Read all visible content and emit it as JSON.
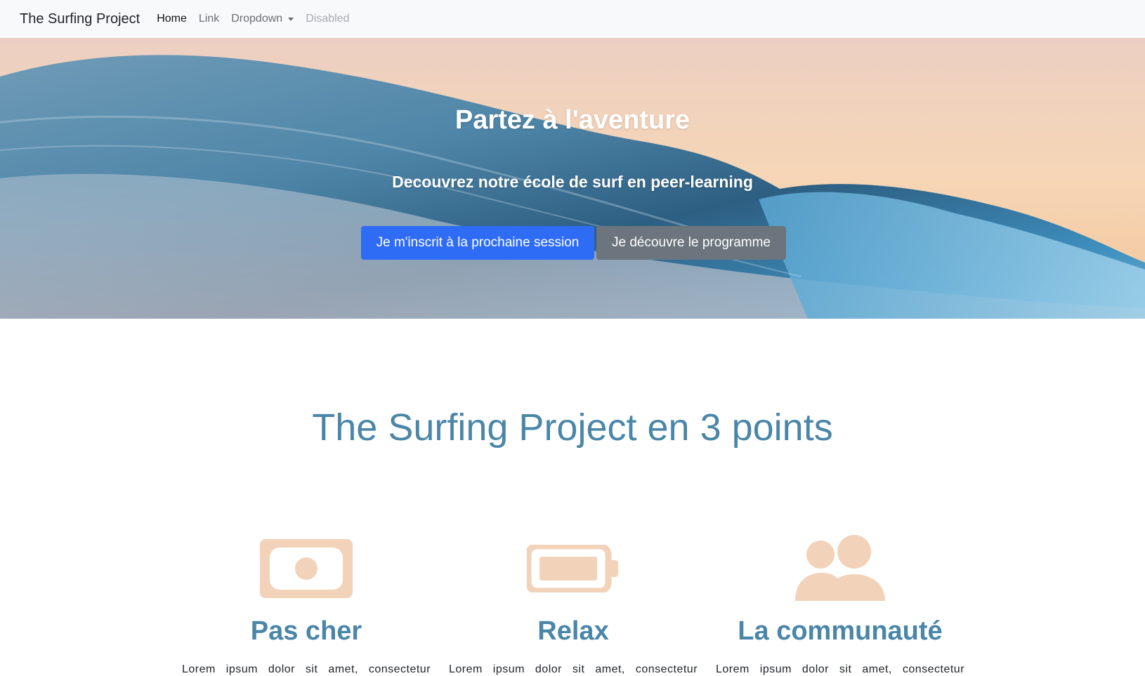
{
  "navbar": {
    "brand": "The Surfing Project",
    "items": [
      {
        "label": "Home"
      },
      {
        "label": "Link"
      },
      {
        "label": "Dropdown"
      },
      {
        "label": "Disabled"
      }
    ]
  },
  "hero": {
    "title": "Partez à l'aventure",
    "subtitle": "Decouvrez notre école de surf en peer-learning",
    "primary_button": "Je m'inscrit à la prochaine session",
    "secondary_button": "Je découvre le programme"
  },
  "points": {
    "title": "The Surfing Project en 3 points",
    "features": [
      {
        "icon": "money-bill-icon",
        "title": "Pas cher",
        "text": "Lorem ipsum dolor sit amet, consectetur"
      },
      {
        "icon": "battery-icon",
        "title": "Relax",
        "text": "Lorem ipsum dolor sit amet, consectetur"
      },
      {
        "icon": "users-icon",
        "title": "La communauté",
        "text": "Lorem ipsum dolor sit amet, consectetur"
      }
    ]
  },
  "colors": {
    "navbar_bg": "#f8f9fa",
    "primary": "#2f6cf6",
    "secondary": "#6c757d",
    "heading": "#4a86a8",
    "icon": "#f2d3b9"
  }
}
